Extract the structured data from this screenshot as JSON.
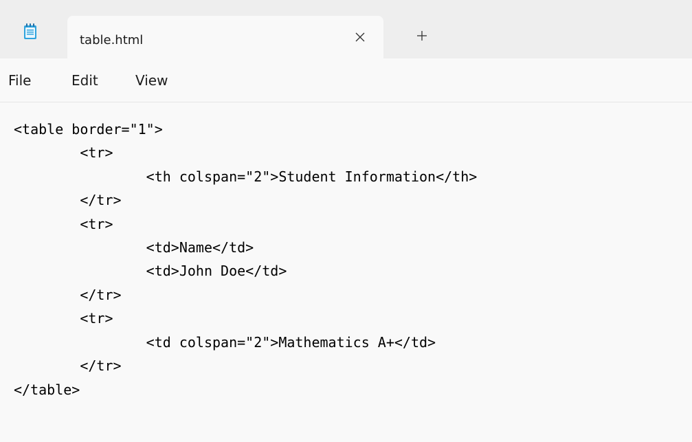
{
  "tab": {
    "title": "table.html"
  },
  "menu": {
    "file": "File",
    "edit": "Edit",
    "view": "View"
  },
  "editor": {
    "lines": [
      "<table border=\"1\">",
      "        <tr>",
      "                <th colspan=\"2\">Student Information</th>",
      "        </tr>",
      "        <tr>",
      "                <td>Name</td>",
      "                <td>John Doe</td>",
      "        </tr>",
      "        <tr>",
      "                <td colspan=\"2\">Mathematics A+</td>",
      "        </tr>",
      "</table>"
    ]
  },
  "colors": {
    "titlebar": "#eeeeee",
    "background": "#f9f9f9",
    "notepad_icon": "#2fa3dd"
  }
}
